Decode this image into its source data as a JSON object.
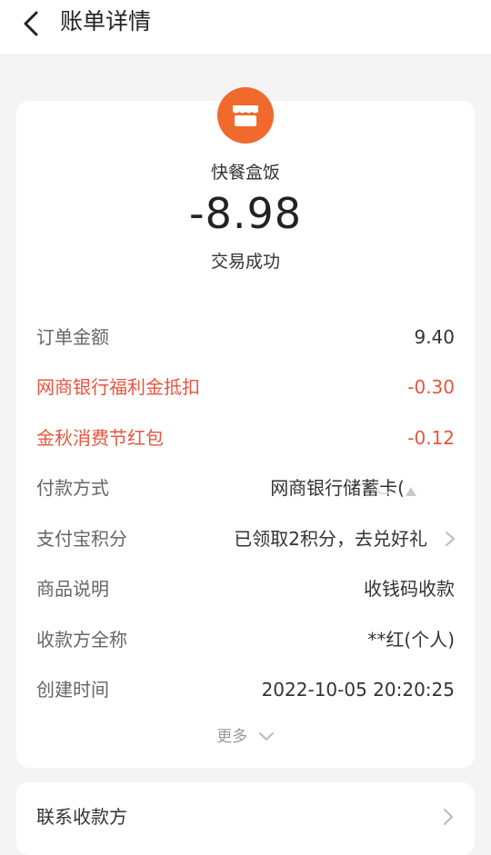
{
  "header": {
    "title": "账单详情",
    "back_icon": "chevron-left-icon"
  },
  "summary": {
    "merchant_icon": "store-icon",
    "merchant_icon_color": "#f06a2e",
    "merchant_name": "快餐盒饭",
    "amount": "-8.98",
    "status": "交易成功"
  },
  "details": {
    "order_amount": {
      "label": "订单金额",
      "value": "9.40"
    },
    "bank_benefit": {
      "label": "网商银行福利金抵扣",
      "value": "-0.30"
    },
    "red_packet": {
      "label": "金秋消费节红包",
      "value": "-0.12"
    },
    "payment_method": {
      "label": "付款方式",
      "value": "网商银行储蓄卡("
    },
    "points": {
      "label": "支付宝积分",
      "value": "已领取2积分，去兑好礼"
    },
    "product_desc": {
      "label": "商品说明",
      "value": "收钱码收款"
    },
    "payee_name": {
      "label": "收款方全称",
      "value": "**红(个人)"
    },
    "created_time": {
      "label": "创建时间",
      "value": "2022-10-05 20:20:25"
    }
  },
  "more": {
    "label": "更多"
  },
  "contact": {
    "label": "联系收款方"
  },
  "colors": {
    "discount": "#e8543f",
    "accent": "#f06a2e"
  }
}
